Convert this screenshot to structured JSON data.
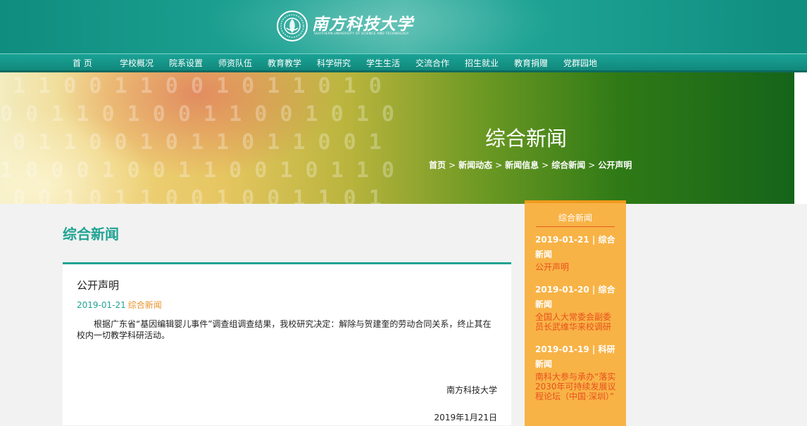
{
  "header": {
    "logo_cn": "南方科技大学",
    "logo_en": "SOUTHERN UNIVERSITY OF SCIENCE AND TECHNOLOGY"
  },
  "nav": {
    "items": [
      "首 页",
      "学校概况",
      "院系设置",
      "师资队伍",
      "教育教学",
      "科学研究",
      "学生生活",
      "交流合作",
      "招生就业",
      "教育捐赠",
      "党群园地"
    ]
  },
  "banner": {
    "title": "综合新闻",
    "breadcrumb": [
      "首页",
      "新闻动态",
      "新闻信息",
      "综合新闻",
      "公开声明"
    ],
    "separator": ">"
  },
  "main": {
    "page_title": "综合新闻",
    "article": {
      "title": "公开声明",
      "date": "2019-01-21",
      "category": "综合新闻",
      "body": "根据广东省“基因编辑婴儿事件”调查组调查结果，我校研究决定：解除与贺建奎的劳动合同关系，终止其在校内一切教学科研活动。",
      "signature": "南方科技大学",
      "sign_date": "2019年1月21日"
    }
  },
  "sidebar": {
    "heading": "综合新闻",
    "items": [
      {
        "meta": "2019-01-21 | 综合新闻",
        "title": "公开声明"
      },
      {
        "meta": "2019-01-20 | 综合新闻",
        "title": "全国人大常委会副委员长武维华来校调研"
      },
      {
        "meta": "2019-01-19 | 科研新闻",
        "title": "南科大参与承办“落实2030年可持续发展议程论坛（中国·深圳）”"
      }
    ]
  },
  "colors": {
    "brand_teal": "#21a393",
    "sidebar_orange": "#f8b346",
    "link_red": "#e8501d",
    "category_orange": "#e8932d"
  }
}
